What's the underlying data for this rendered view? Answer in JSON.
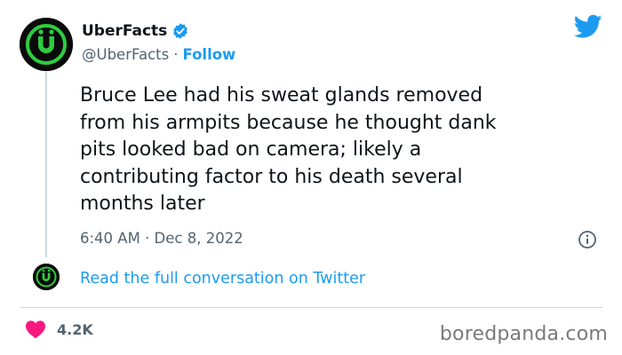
{
  "author": {
    "name": "UberFacts",
    "handle": "@UberFacts",
    "separator": "·",
    "follow_label": "Follow",
    "avatar_glyph": "Ü",
    "verified": true
  },
  "tweet": {
    "lines": [
      "Bruce Lee had his sweat glands removed",
      "from his armpits because he thought dank",
      "pits looked bad on camera; likely a",
      "contributing factor to his death several",
      "months later"
    ],
    "timestamp": "6:40 AM · Dec 8, 2022"
  },
  "conversation": {
    "link_label": "Read the full conversation on Twitter"
  },
  "stats": {
    "likes": "4.2K"
  },
  "watermark": "boredpanda.com",
  "colors": {
    "accent": "#1d9bf0",
    "text": "#0f1419",
    "muted": "#536471",
    "heart": "#f91880",
    "avatar_ring": "#2ecc40",
    "avatar_bg": "#0a0a0a"
  }
}
